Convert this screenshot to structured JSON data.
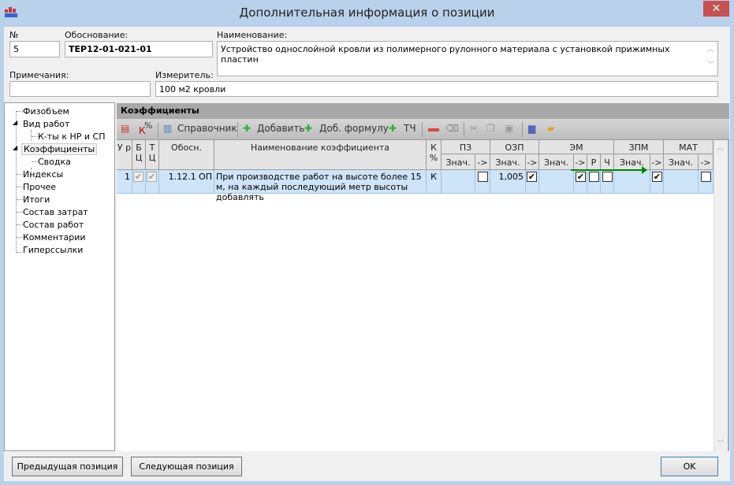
{
  "window": {
    "title": "Дополнительная информация о позиции",
    "close": "✕"
  },
  "form": {
    "number_label": "№",
    "number_value": "5",
    "basis_label": "Обоснование:",
    "basis_value": "ТЕР12-01-021-01",
    "name_label": "Наименование:",
    "name_value": "Устройство однослойной кровли из полимерного рулонного материала с установкой прижимных пластин",
    "notes_label": "Примечания:",
    "notes_value": "",
    "unit_label": "Измеритель:",
    "unit_value": "100 м2 кровли"
  },
  "tree": {
    "items": [
      {
        "label": "Физобъем"
      },
      {
        "label": "Вид работ"
      },
      {
        "label": "К-ты к НР и СП"
      },
      {
        "label": "Коэффициенты"
      },
      {
        "label": "Сводка"
      },
      {
        "label": "Индексы"
      },
      {
        "label": "Прочее"
      },
      {
        "label": "Итоги"
      },
      {
        "label": "Состав затрат"
      },
      {
        "label": "Состав работ"
      },
      {
        "label": "Комментарии"
      },
      {
        "label": "Гиперссылки"
      }
    ]
  },
  "section": {
    "title": "Коэффициенты"
  },
  "toolbar": {
    "k_percent": "%",
    "k_letter": "К",
    "reference": "Справочник",
    "add": "Добавить",
    "add_formula": "Доб. формулу",
    "tch": "ТЧ"
  },
  "grid": {
    "headers": {
      "ur": "У р",
      "bc": "Б Ц",
      "tc": "Т Ц",
      "basis": "Обосн.",
      "name": "Наименование коэффициента",
      "kp": "К %",
      "pz": "ПЗ",
      "ozp": "ОЗП",
      "em": "ЭМ",
      "zpm": "ЗПМ",
      "mat": "МАТ",
      "val": "Знач.",
      "arrow": "->",
      "r": "Р",
      "ch": "Ч"
    },
    "rows": [
      {
        "ur": "1",
        "bc": true,
        "tc": true,
        "basis": "1.12.1 ОП",
        "name": "При производстве работ на высоте более 15 м, на каждый последующий метр высоты добавлять",
        "kp": "К",
        "pz_val": "",
        "pz_arrow": false,
        "ozp_val": "1,005",
        "ozp_arrow": true,
        "em_val": "",
        "em_arrow": true,
        "em_r": false,
        "em_ch": false,
        "zpm_val": "",
        "zpm_arrow": true,
        "mat_val": "",
        "mat_arrow": false
      }
    ]
  },
  "buttons": {
    "prev": "Предыдущая позиция",
    "next": "Следующая позиция",
    "ok": "OK"
  },
  "colors": {
    "titlebar": "#b9d1ea",
    "row_selected": "#cde4f9",
    "close": "#c75050"
  }
}
